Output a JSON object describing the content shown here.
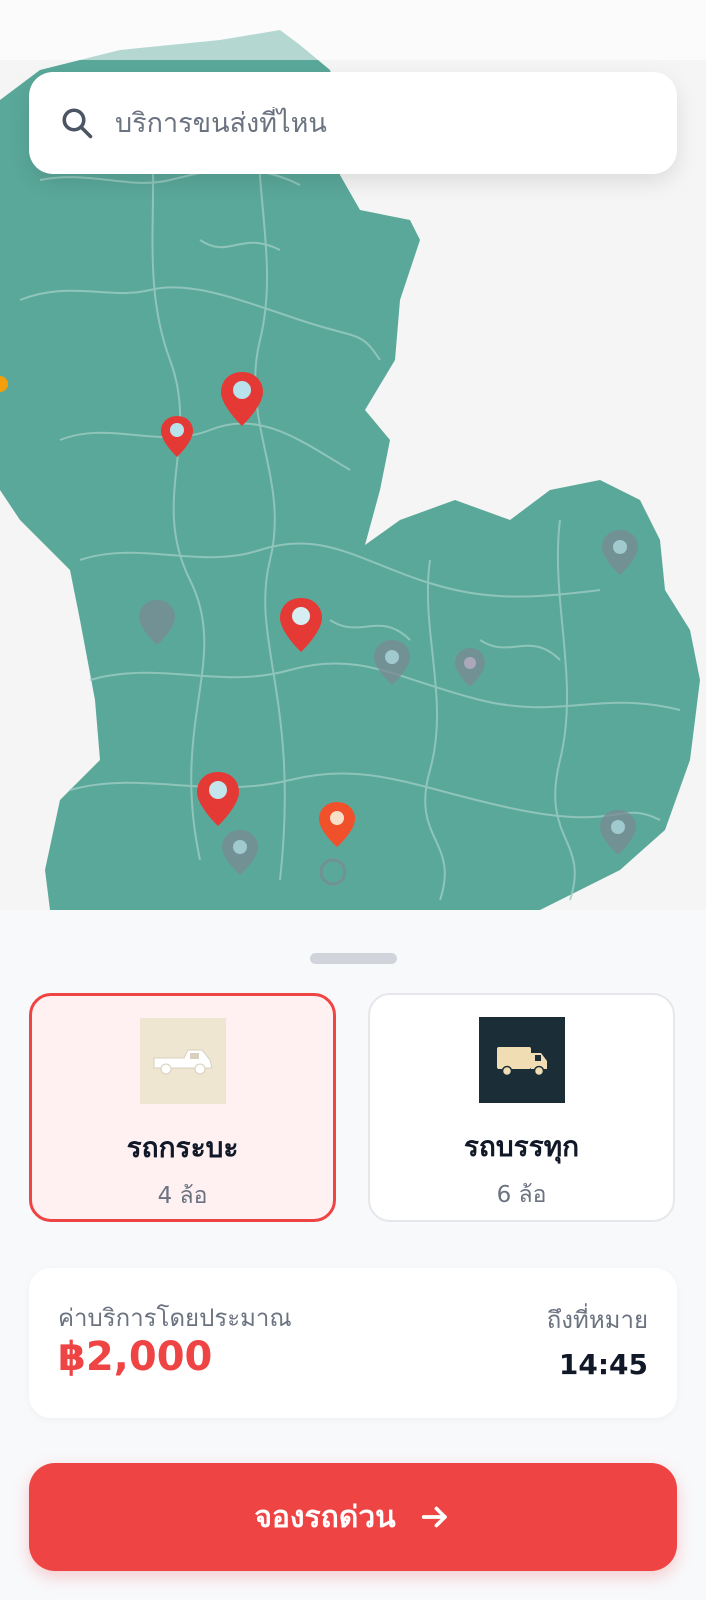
{
  "search": {
    "placeholder": "บริการขนส่งที่ไหน",
    "icon": "search-icon"
  },
  "map": {
    "land_color": "#5aa89a",
    "pin_active_color": "#e53935",
    "pin_inactive_color": "#7b8a93",
    "pins_active": 6,
    "pins_inactive": 7
  },
  "vehicles": [
    {
      "name": "รถกระบะ",
      "sub": "4 ล้อ",
      "icon": "pickup-truck-icon",
      "selected": true
    },
    {
      "name": "รถบรรทุก",
      "sub": "6 ล้อ",
      "icon": "truck-icon",
      "selected": false
    }
  ],
  "price": {
    "label": "ค่าบริการโดยประมาณ",
    "value": "฿2,000"
  },
  "eta": {
    "label": "ถึงที่หมาย",
    "value": "14:45"
  },
  "book_button": {
    "label": "จองรถด่วน",
    "icon": "arrow-right-icon"
  },
  "colors": {
    "accent": "#ef4444",
    "selected_bg": "#fff1f2",
    "sheet_bg": "#f8f9fb",
    "truck_tile": "#1b2e38",
    "pickup_tile": "#efe6d2"
  }
}
